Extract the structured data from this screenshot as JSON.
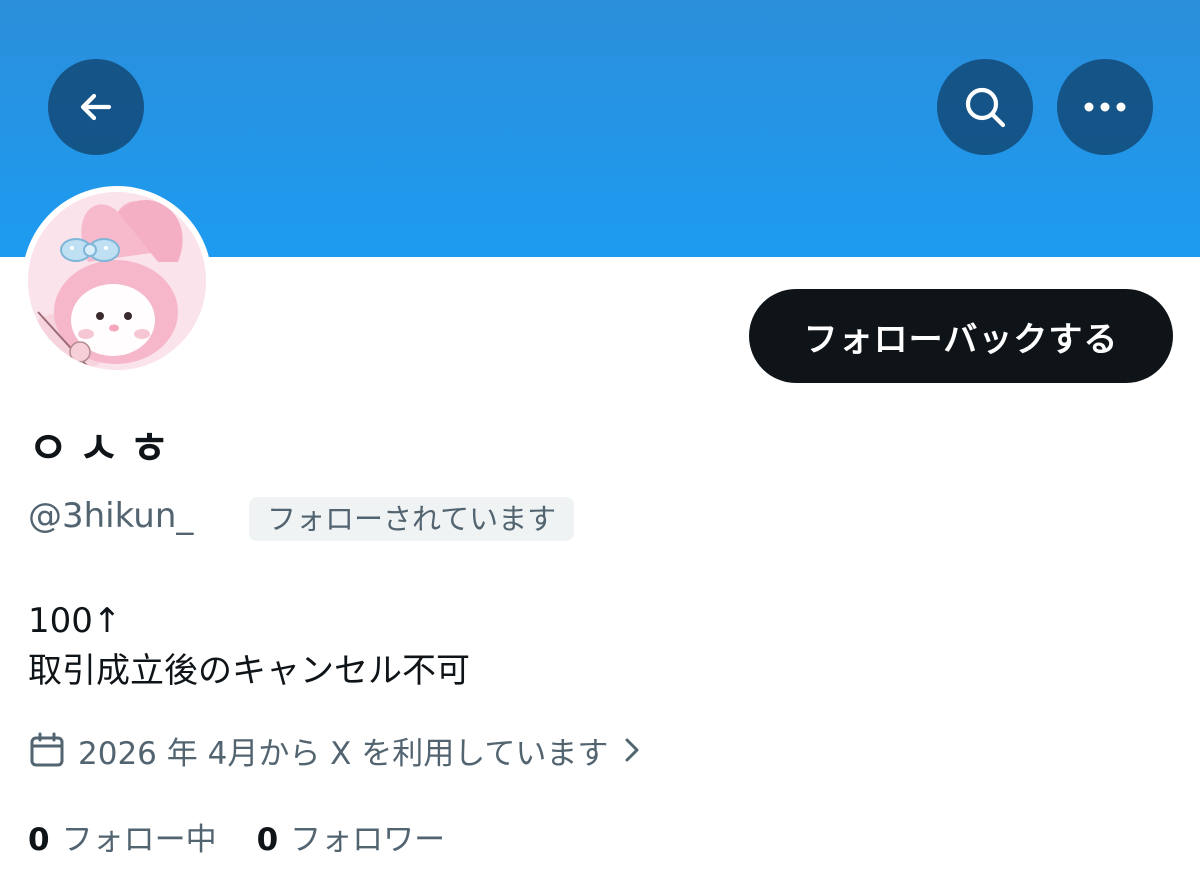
{
  "profile": {
    "display_name": "ㅇㅅㅎ",
    "handle": "@3hikun_",
    "follows_you_badge": "フォローされています",
    "follow_button": "フォローバックする",
    "bio": [
      "100↑",
      "取引成立後のキャンセル不可"
    ],
    "joined": "2026 年 4月から X を利用しています",
    "following_count": "0",
    "following_label": "フォロー中",
    "followers_count": "0",
    "followers_label": "フォロワー"
  },
  "icons": {
    "back": "arrow-left-icon",
    "search": "search-icon",
    "more": "more-horizontal-icon",
    "calendar": "calendar-icon",
    "chevron": "chevron-right-icon"
  },
  "colors": {
    "banner": "#1d9bf0",
    "primary_text": "#0f1419",
    "secondary_text": "#536471",
    "button_bg": "#0f1419",
    "badge_bg": "#eff3f4"
  }
}
